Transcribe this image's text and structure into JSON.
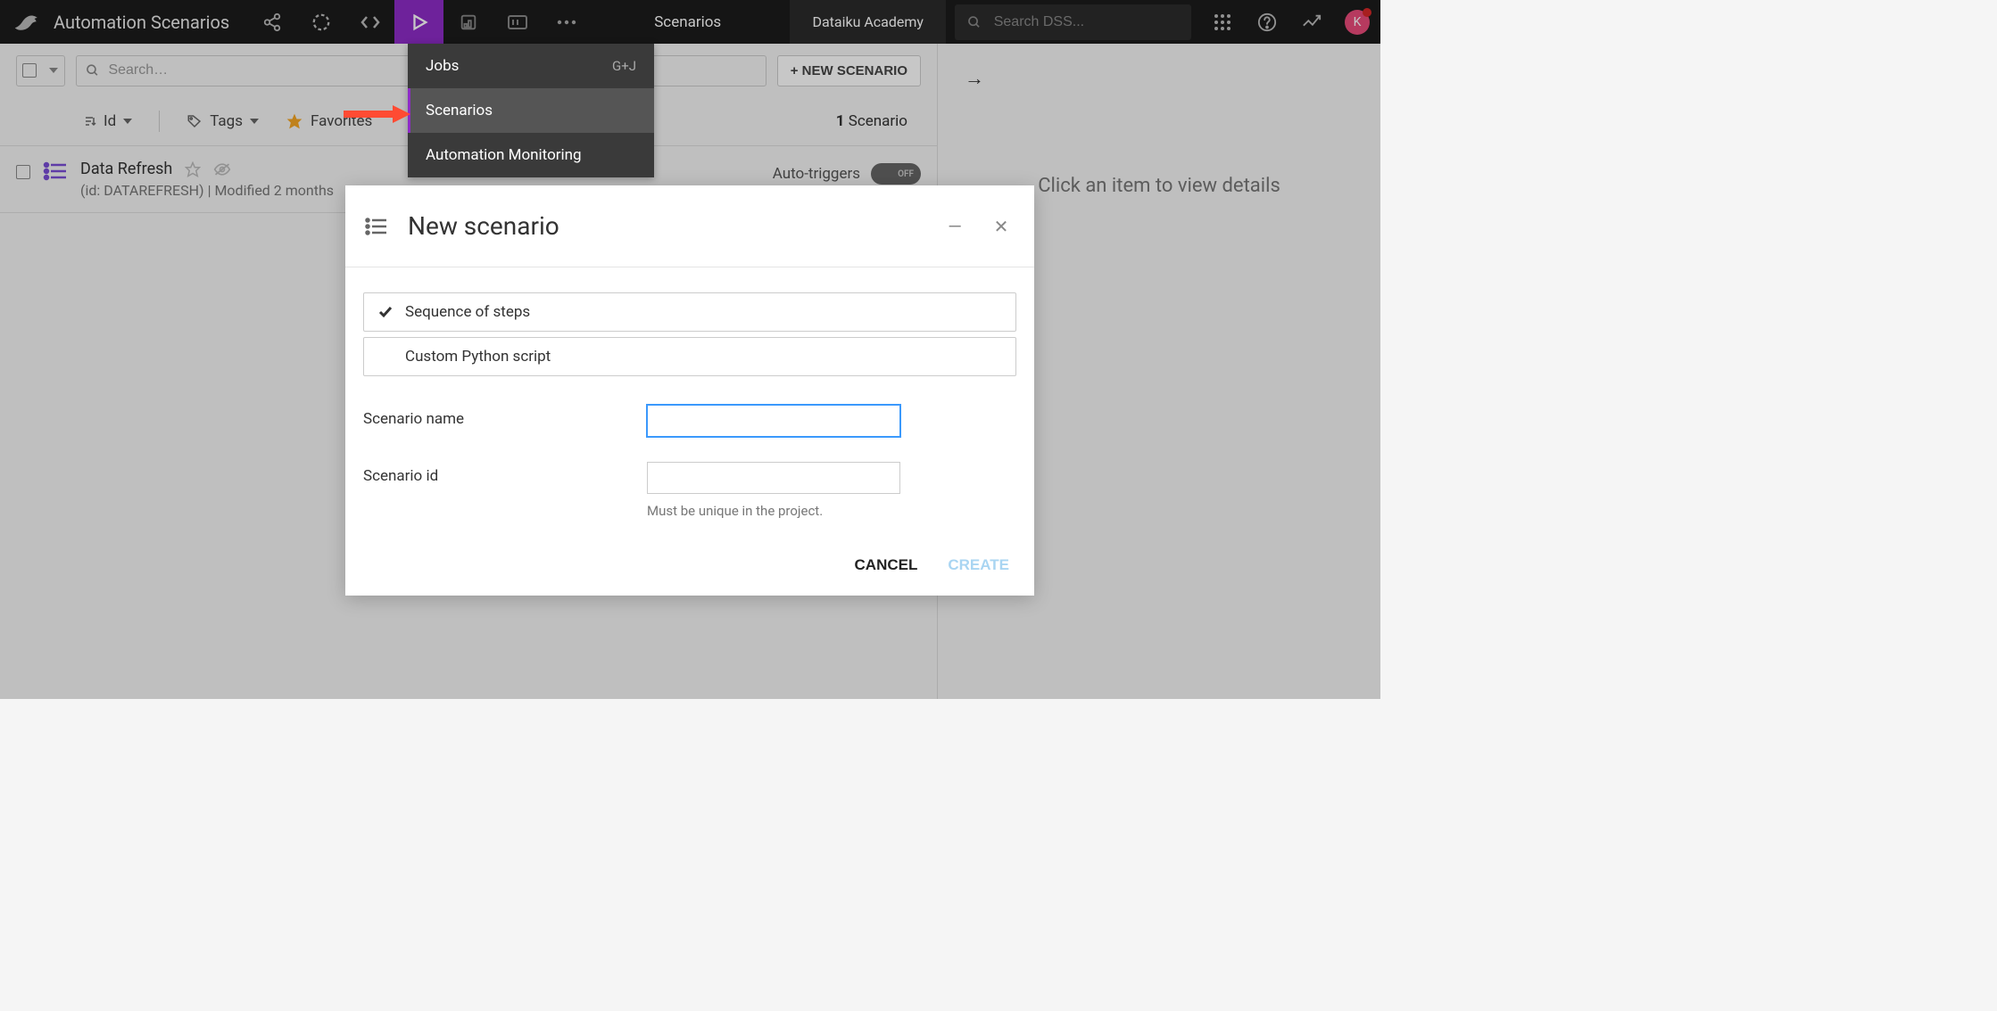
{
  "topbar": {
    "project_title": "Automation Scenarios",
    "center_label": "Scenarios",
    "academy_label": "Dataiku Academy",
    "search_placeholder": "Search DSS...",
    "avatar_initial": "K"
  },
  "dropdown": {
    "items": [
      {
        "label": "Jobs",
        "shortcut": "G+J",
        "active": false
      },
      {
        "label": "Scenarios",
        "shortcut": "",
        "active": true
      },
      {
        "label": "Automation Monitoring",
        "shortcut": "",
        "active": false
      }
    ]
  },
  "toolbar": {
    "search_placeholder": "Search…",
    "new_button": "+ NEW SCENARIO",
    "sort_label": "Id",
    "tags_label": "Tags",
    "favorites_label": "Favorites",
    "count_number": "1",
    "count_label": "Scenario"
  },
  "list": {
    "item": {
      "title": "Data Refresh",
      "meta": "(id: DATAREFRESH) | Modified 2 months",
      "auto_triggers_label": "Auto-triggers",
      "toggle_text": "OFF"
    }
  },
  "right": {
    "placeholder": "Click an item to view details"
  },
  "modal": {
    "title": "New scenario",
    "option_sequence": "Sequence of steps",
    "option_python": "Custom Python script",
    "label_name": "Scenario name",
    "label_id": "Scenario id",
    "hint": "Must be unique in the project.",
    "cancel": "CANCEL",
    "create": "CREATE"
  }
}
